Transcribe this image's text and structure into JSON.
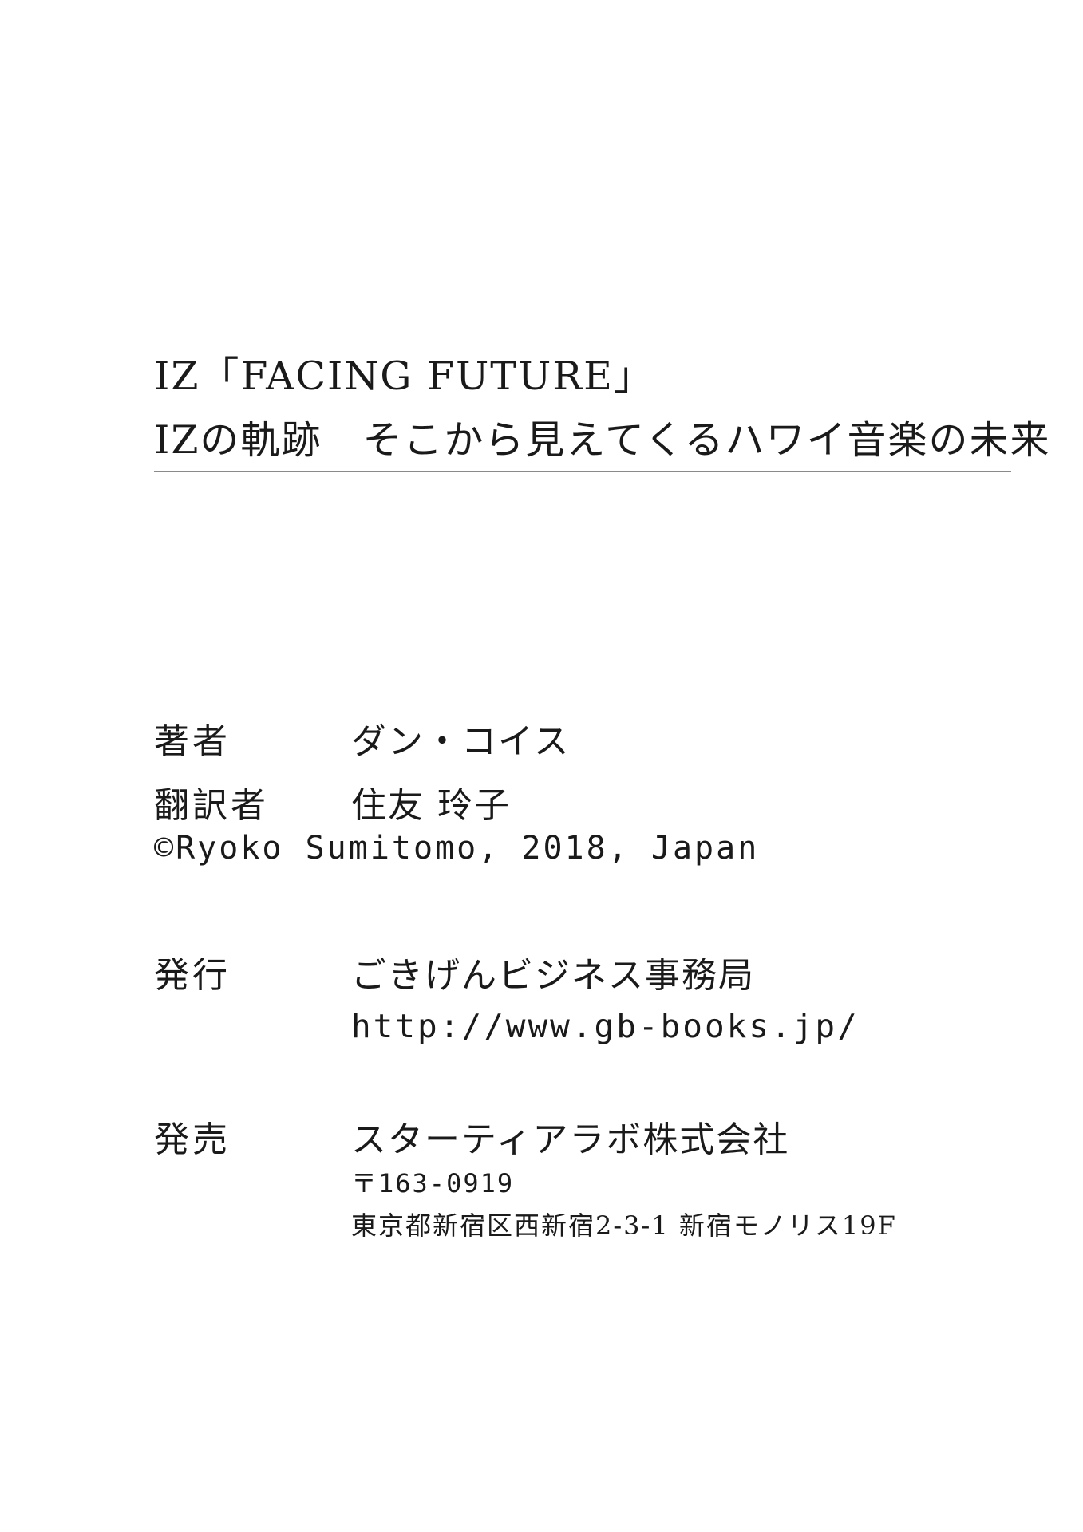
{
  "title": {
    "line1": "IZ「FACING FUTURE」",
    "line2": "IZの軌跡　そこから見えてくるハワイ音楽の未来"
  },
  "credits": {
    "author_label": "著者",
    "author_name": "ダン・コイス",
    "translator_label": "翻訳者",
    "translator_name": "住友 玲子",
    "copyright": "©Ryoko Sumitomo, 2018, Japan"
  },
  "publisher": {
    "label": "発行",
    "name": "ごきげんビジネス事務局",
    "url": "http://www.gb-books.jp/"
  },
  "distributor": {
    "label": "発売",
    "name": "スターティアラボ株式会社",
    "postal": "〒163-0919",
    "address": "東京都新宿区西新宿2-3-1 新宿モノリス19F"
  }
}
